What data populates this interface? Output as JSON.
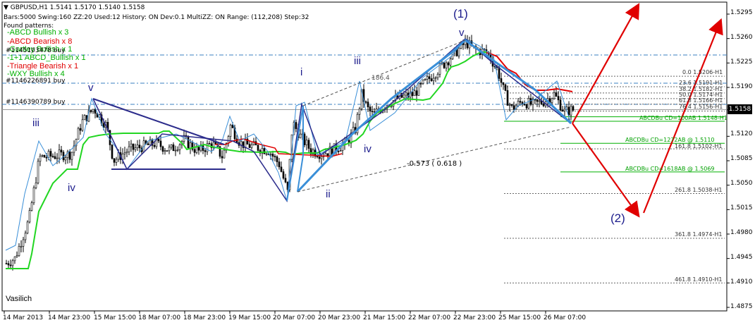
{
  "header": {
    "symbol_line": "▼ GBPUSD,H1  1.5141 1.5170 1.5140 1.5158",
    "params_line": "Bars:5000  Swing:160  ZZ:20  Used:12  History: ON Dev:0.1  MultiZZ: ON  Range: (112,208)  Step:32",
    "found_label": "Found patterns:"
  },
  "patterns": [
    {
      "text": "-ABCD Bullish x 3",
      "color": "#00b000"
    },
    {
      "text": "-ABCD Bearish x 8",
      "color": "#e00000"
    },
    {
      "text": "-Gartley Bullish x 1",
      "color": "#00b000"
    },
    {
      "text": "-1+1 ABCD_Bullish x 1",
      "color": "#00b000"
    },
    {
      "text": "-Triangle Bearish x 1",
      "color": "#e00000"
    },
    {
      "text": "-WXY Bullish x 4",
      "color": "#00b000"
    }
  ],
  "orders": [
    "#1145103478 buy",
    "#1146226891 buy",
    "#1146390789 buy"
  ],
  "waves": [
    {
      "label": "(1)",
      "size": "large"
    },
    {
      "label": "(2)",
      "size": "large"
    },
    {
      "label": "v",
      "size": "small"
    },
    {
      "label": "iii",
      "size": "small"
    },
    {
      "label": "iv",
      "size": "small"
    },
    {
      "label": "v",
      "size": "small"
    },
    {
      "label": "i",
      "size": "small"
    },
    {
      "label": "ii",
      "size": "small"
    },
    {
      "label": "iii",
      "size": "small"
    },
    {
      "label": "iv",
      "size": "small"
    },
    {
      "label": "v",
      "size": "small"
    }
  ],
  "yaxis": [
    "1.5295",
    "1.5260",
    "1.5225",
    "1.5190",
    "1.5158",
    "1.5120",
    "1.5085",
    "1.5050",
    "1.5015",
    "1.4980",
    "1.4945",
    "1.4910",
    "1.4875"
  ],
  "current_price": "1.5158",
  "xaxis": [
    "14 Mar 2013",
    "14 Mar 23:00",
    "15 Mar 15:00",
    "18 Mar 07:00",
    "18 Mar 23:00",
    "19 Mar 15:00",
    "20 Mar 07:00",
    "20 Mar 23:00",
    "21 Mar 15:00",
    "22 Mar 07:00",
    "22 Mar 23:00",
    "25 Mar 15:00",
    "26 Mar 07:00"
  ],
  "fib_levels": [
    "0.0 1.5206-H1",
    "23.6 1.5191-H1",
    "38.2 1.5182-H1",
    "50.0 1.5174-H1",
    "61.8 1.5166-H1",
    "76.4 1.5156-H1",
    "161.8 1.5102-H1",
    "261.8 1.5038-H1",
    "361.8 1.4974-H1",
    "461.8 1.4910-H1"
  ],
  "abcd_levels": [
    "ABCDBu CD=100AB 1.5148-H1",
    "ABCDBu CD=1272AB @ 1.5110",
    "ABCDBu CD=1618AB @ 1.5069"
  ],
  "annotations": {
    "ratio1": "-0.573 ( 0.618 )",
    "ratio2": "186.4"
  },
  "signature": "Vasilich",
  "colors": {
    "bull": "#00b000",
    "bear": "#e00000",
    "wave": "#1c1c8c",
    "zigzag": "#3a8fd8",
    "arrow": "#e00000",
    "ma_green": "#22d622",
    "ma_red": "#e00000"
  },
  "chart_data": {
    "type": "candlestick",
    "symbol": "GBPUSD",
    "timeframe": "H1",
    "ylim": [
      1.4875,
      1.5295
    ],
    "ohlc_last": {
      "open": 1.5141,
      "high": 1.517,
      "low": 1.514,
      "close": 1.5158
    },
    "wave_points": [
      {
        "label": "v",
        "time": "15 Mar 15:00",
        "price": 1.5178
      },
      {
        "label": "(1)",
        "time": "22 Mar 23:00",
        "price": 1.5262
      },
      {
        "label": "i",
        "time": "20 Mar 15:00",
        "price": 1.5168
      },
      {
        "label": "ii",
        "time": "20 Mar 07:00",
        "price": 1.503
      },
      {
        "label": "(2)",
        "time": "27 Mar",
        "price": 1.5015
      }
    ],
    "fib_levels": [
      1.5206,
      1.5191,
      1.5182,
      1.5174,
      1.5166,
      1.5156,
      1.5102,
      1.5038,
      1.4974,
      1.491
    ],
    "abcd_targets": [
      1.5148,
      1.511,
      1.5069
    ]
  }
}
